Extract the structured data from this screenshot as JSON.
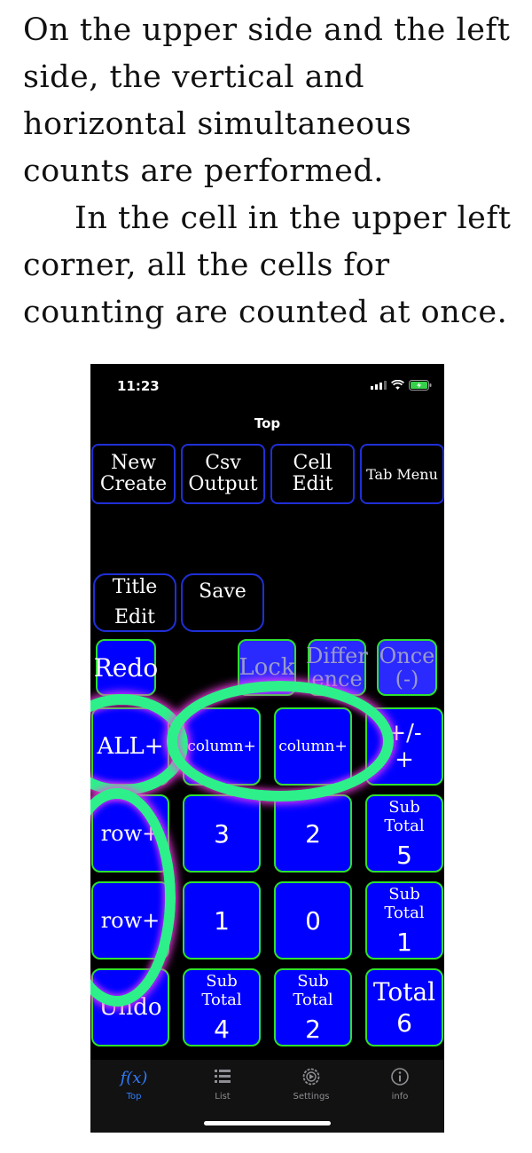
{
  "intro": {
    "p1": "On the upper side and the left side, the vertical and horizontal simultaneous counts are performed.",
    "p2": "In the cell in the upper left corner, all the cells for counting are counted at once."
  },
  "status": {
    "time": "11:23"
  },
  "nav": {
    "title": "Top"
  },
  "toolbar": {
    "new_create": "New\nCreate",
    "csv_output": "Csv\nOutput",
    "cell_edit": "Cell\nEdit",
    "tab_menu": "Tab Menu",
    "title_edit": "Title\nEdit",
    "save": "Save"
  },
  "controls": {
    "redo": "Redo",
    "lock": "Lock",
    "difference": "Differ\nence",
    "once": "Once\n(-)"
  },
  "grid": {
    "all_plus": "ALL+",
    "column1": "column+",
    "column2": "column+",
    "plusminus": "+/-\n+",
    "row1": "row+",
    "row2": "row+",
    "undo": "Undo",
    "cell_r1c1": "3",
    "cell_r1c2": "2",
    "cell_r2c1": "1",
    "cell_r2c2": "0",
    "subtotal_label": "Sub Total",
    "total_label": "Total",
    "row1_subtotal": "5",
    "row2_subtotal": "1",
    "col1_subtotal": "4",
    "col2_subtotal": "2",
    "total": "6"
  },
  "tabbar": {
    "top": "Top",
    "top_icon": "f(x)",
    "list": "List",
    "settings": "Settings",
    "info": "info"
  },
  "colors": {
    "key_fill": "#0000ff",
    "key_border": "#2ee02e",
    "toolbar_border": "#1f2fd6",
    "highlight_ring": "#2ef08a",
    "highlight_glow": "#ff3cf0",
    "tab_active": "#2f7dff"
  }
}
